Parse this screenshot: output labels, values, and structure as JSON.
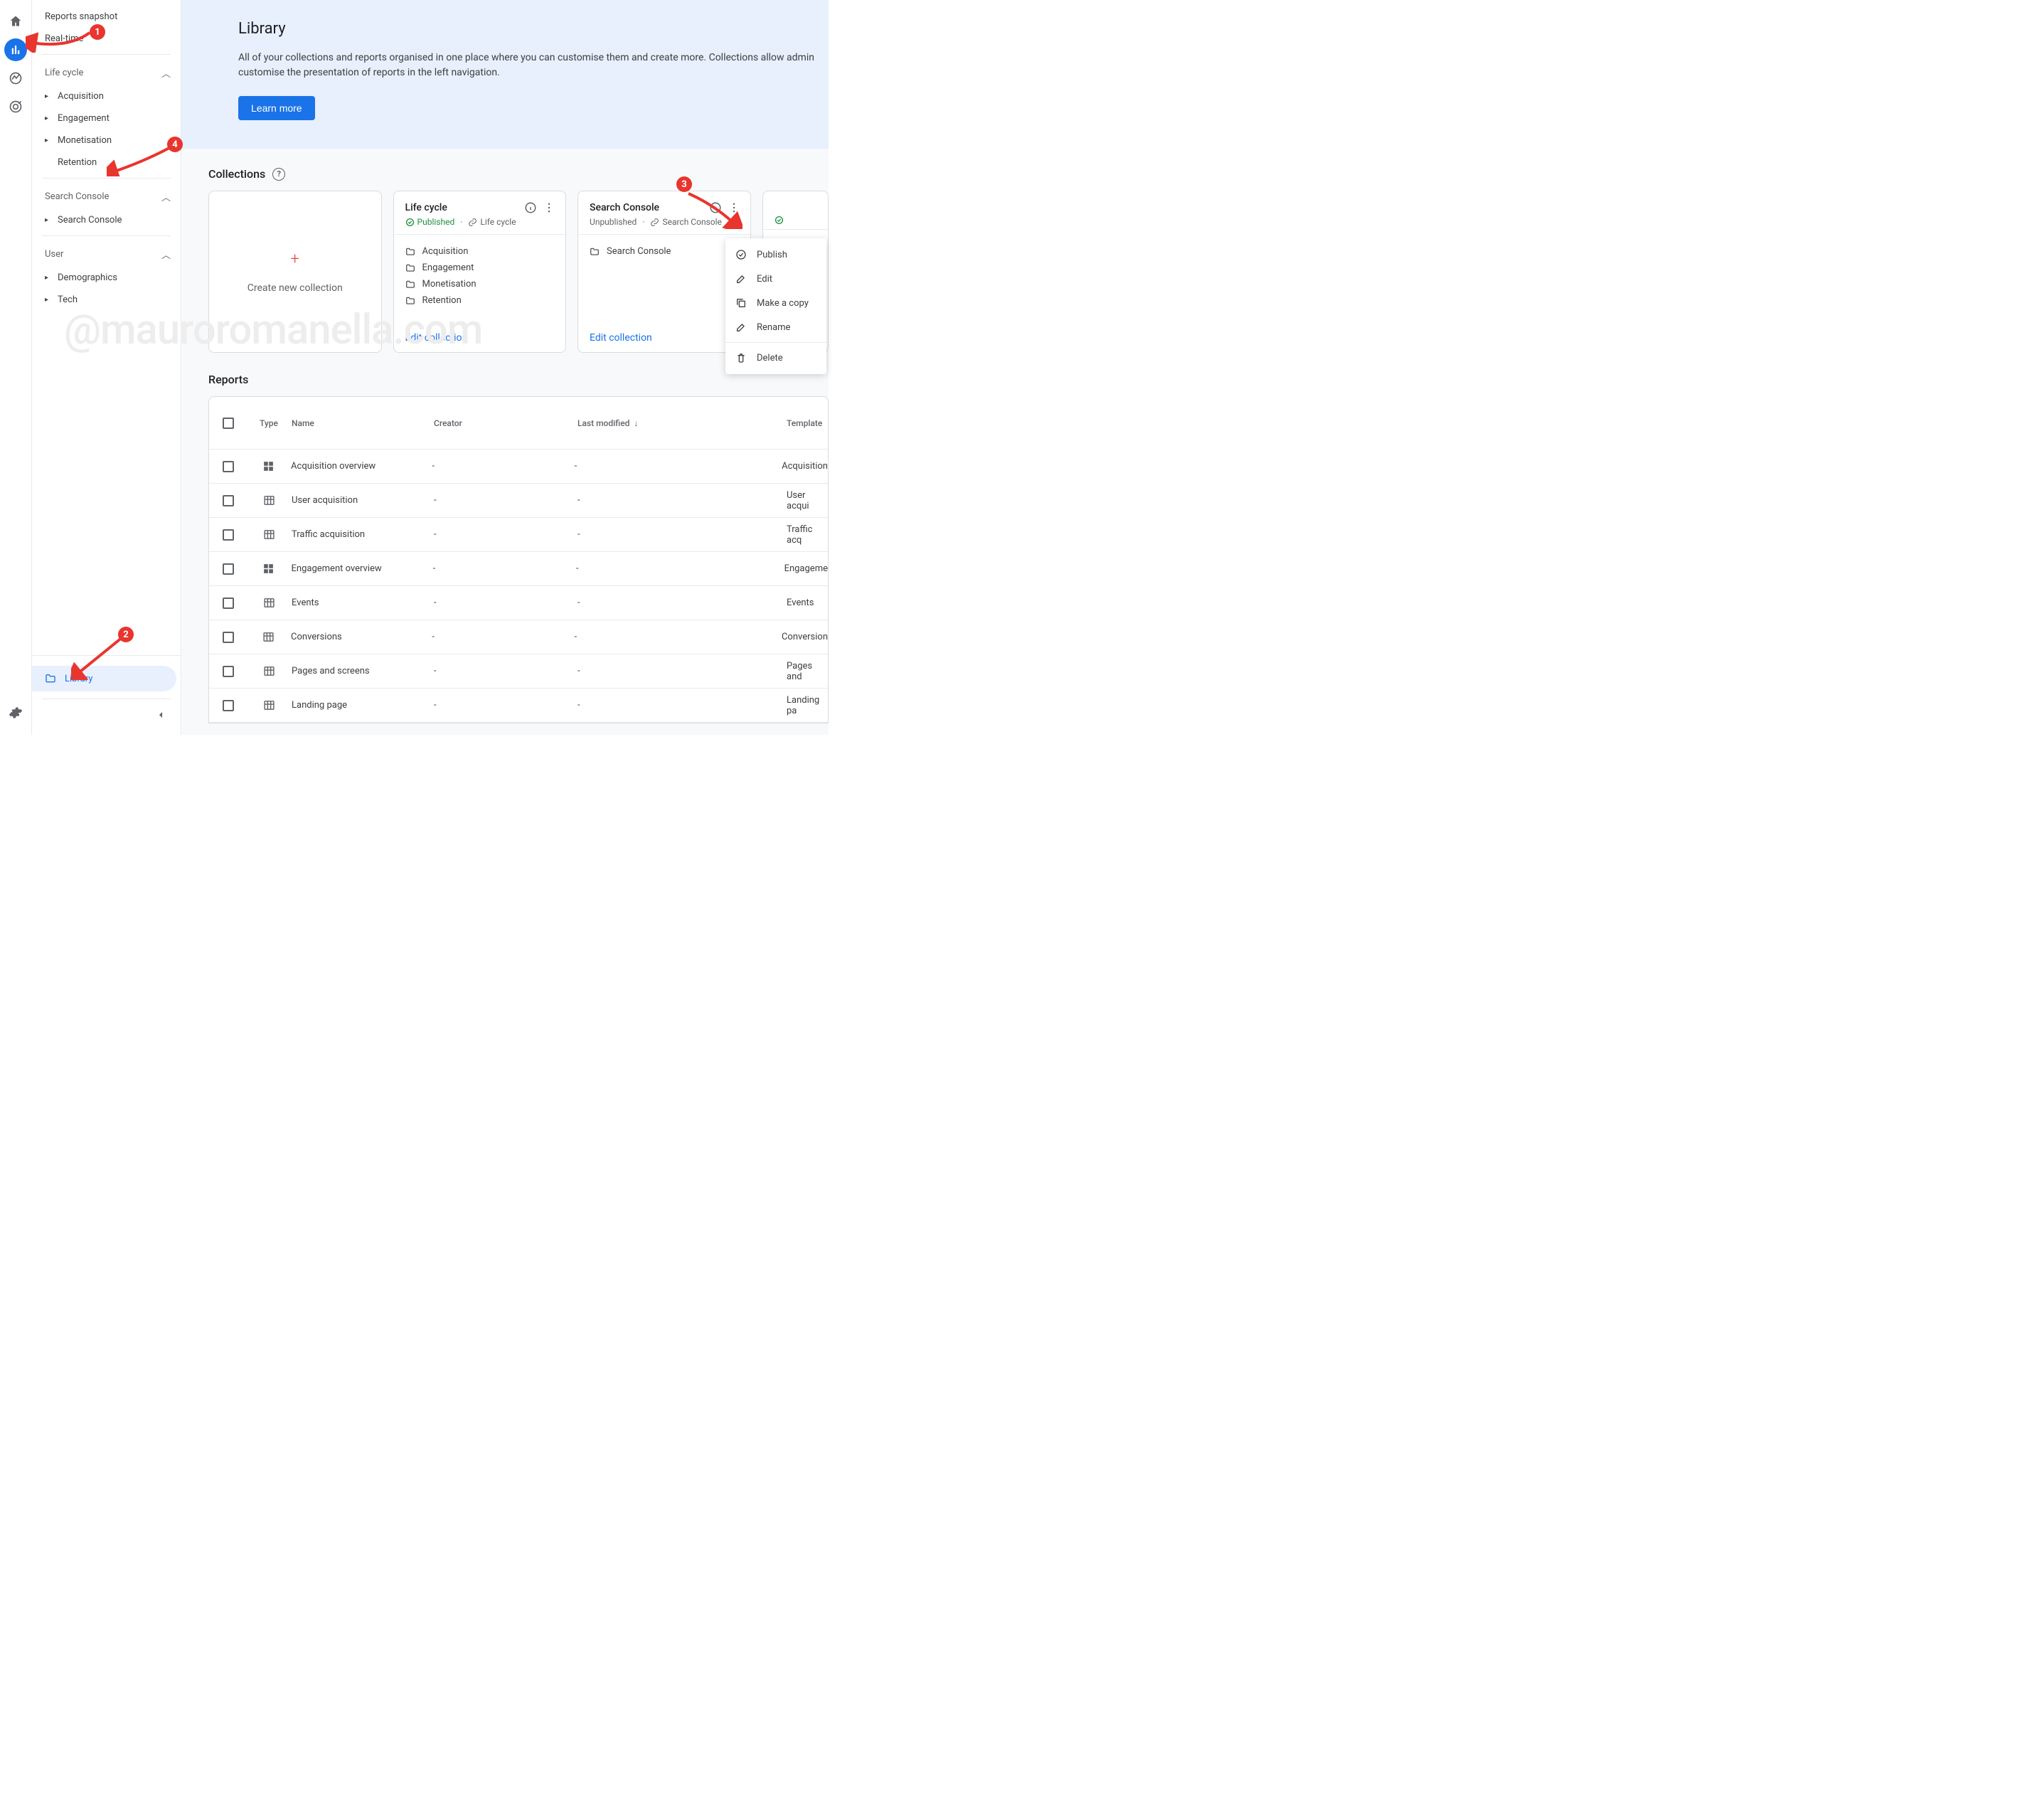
{
  "sidebar": {
    "top": [
      {
        "label": "Reports snapshot"
      },
      {
        "label": "Real-time"
      }
    ],
    "sections": [
      {
        "label": "Life cycle",
        "items": [
          {
            "label": "Acquisition"
          },
          {
            "label": "Engagement"
          },
          {
            "label": "Monetisation"
          },
          {
            "label": "Retention",
            "no_caret": true
          }
        ]
      },
      {
        "label": "Search Console",
        "items": [
          {
            "label": "Search Console"
          }
        ]
      },
      {
        "label": "User",
        "items": [
          {
            "label": "Demographics"
          },
          {
            "label": "Tech"
          }
        ]
      }
    ],
    "library_label": "Library"
  },
  "hero": {
    "title": "Library",
    "desc": "All of your collections and reports organised in one place where you can customise them and create more. Collections allow admin customise the presentation of reports in the left navigation.",
    "learn_more": "Learn more"
  },
  "collections": {
    "title": "Collections",
    "create_label": "Create new collection",
    "edit_label": "Edit collection",
    "cards": [
      {
        "title": "Life cycle",
        "status": "Published",
        "linked": "Life cycle",
        "items": [
          "Acquisition",
          "Engagement",
          "Monetisation",
          "Retention"
        ]
      },
      {
        "title": "Search Console",
        "status": "Unpublished",
        "linked": "Search Console",
        "items": [
          "Search Console"
        ]
      }
    ]
  },
  "dropdown": {
    "publish": "Publish",
    "edit": "Edit",
    "copy": "Make a copy",
    "rename": "Rename",
    "delete": "Delete"
  },
  "reports": {
    "title": "Reports",
    "columns": {
      "type": "Type",
      "name": "Name",
      "creator": "Creator",
      "last_mod": "Last modified",
      "template": "Template"
    },
    "rows": [
      {
        "name": "Acquisition overview",
        "creator": "-",
        "mod": "-",
        "template": "Acquisition",
        "t": "overview"
      },
      {
        "name": "User acquisition",
        "creator": "-",
        "mod": "-",
        "template": "User acqui",
        "t": "table"
      },
      {
        "name": "Traffic acquisition",
        "creator": "-",
        "mod": "-",
        "template": "Traffic acq",
        "t": "table"
      },
      {
        "name": "Engagement overview",
        "creator": "-",
        "mod": "-",
        "template": "Engageme",
        "t": "overview"
      },
      {
        "name": "Events",
        "creator": "-",
        "mod": "-",
        "template": "Events",
        "t": "table"
      },
      {
        "name": "Conversions",
        "creator": "-",
        "mod": "-",
        "template": "Conversion",
        "t": "table"
      },
      {
        "name": "Pages and screens",
        "creator": "-",
        "mod": "-",
        "template": "Pages and",
        "t": "table"
      },
      {
        "name": "Landing page",
        "creator": "-",
        "mod": "-",
        "template": "Landing pa",
        "t": "table"
      }
    ]
  },
  "watermark": "@mauroromanella.com",
  "annotations": {
    "1": "1",
    "2": "2",
    "3": "3",
    "4": "4"
  }
}
